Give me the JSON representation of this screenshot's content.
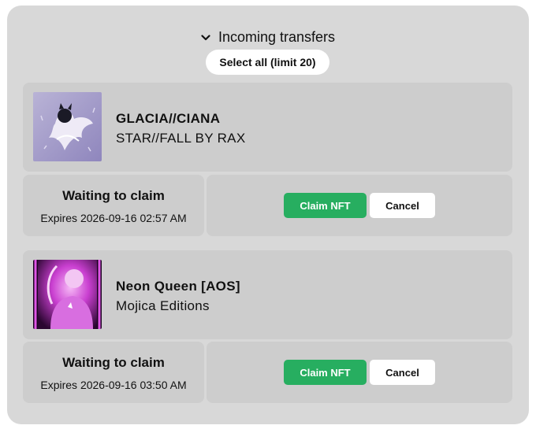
{
  "header": {
    "icon": "chevron-down-icon",
    "title": "Incoming transfers",
    "select_all_label": "Select all (limit 20)"
  },
  "transfers": [
    {
      "name": "GLACIA//CIANA",
      "collection": "STAR//FALL BY RAX",
      "status": "Waiting to claim",
      "expires": "Expires 2026-09-16 02:57 AM",
      "claim_label": "Claim NFT",
      "cancel_label": "Cancel"
    },
    {
      "name": "Neon Queen [AOS]",
      "collection": "Mojica Editions",
      "status": "Waiting to claim",
      "expires": "Expires 2026-09-16 03:50 AM",
      "claim_label": "Claim NFT",
      "cancel_label": "Cancel"
    }
  ],
  "colors": {
    "panel_bg": "#d8d8d8",
    "card_bg": "#cdcdcd",
    "claim_green": "#27ae60"
  }
}
